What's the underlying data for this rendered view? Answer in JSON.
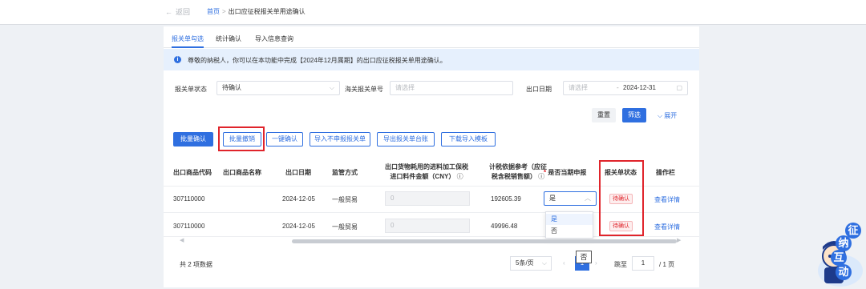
{
  "header": {
    "back_label": "返回",
    "breadcrumb_home": "首页",
    "breadcrumb_sep": ">",
    "breadcrumb_current": "出口应征税报关单用途确认"
  },
  "tabs": [
    "报关单勾选",
    "统计确认",
    "导入信息查询"
  ],
  "notice": {
    "icon": "info-icon",
    "text": "尊敬的纳税人，你可以在本功能中完成【2024年12月属期】的出口应征税报关单用途确认。"
  },
  "filters": {
    "status_label": "报关单状态",
    "status_value": "待确认",
    "customs_no_label": "海关报关单号",
    "customs_no_placeholder": "请选择",
    "export_date_label": "出口日期",
    "date_start_placeholder": "请选择",
    "date_sep": "-",
    "date_end": "2024-12-31",
    "reset_label": "重置",
    "search_label": "筛选",
    "expand_label": "展开"
  },
  "toolbar": {
    "batch_confirm": "批量确认",
    "batch_cancel": "批量撤销",
    "one_click_confirm": "一键确认",
    "import_no_declare": "导入不申报报关单",
    "export_ledger": "导出报关单台账",
    "download_template": "下载导入模板"
  },
  "table": {
    "headers": {
      "code": "出口商品代码",
      "name": "出口商品名称",
      "date": "出口日期",
      "supervision": "监管方式",
      "amount_l1": "出口货物耗用的进料加工保税",
      "amount_l2": "进口料件金额（CNY）",
      "basis_l1": "计税依据参考（应征",
      "basis_l2": "税含税销售额）",
      "declare": "是否当期申报",
      "declare_required": "*",
      "status": "报关单状态",
      "action": "操作栏"
    },
    "rows": [
      {
        "code": "307110000",
        "name": "",
        "date": "2024-12-05",
        "supervision": "一般贸易",
        "amount": "0",
        "basis": "192605.39",
        "declare": "是",
        "status": "待确认",
        "action": "查看详情"
      },
      {
        "code": "307110000",
        "name": "",
        "date": "2024-12-05",
        "supervision": "一般贸易",
        "amount": "0",
        "basis": "49996.48",
        "declare": "",
        "status": "待确认",
        "action": "查看详情"
      }
    ],
    "declare_options": [
      "是",
      "否"
    ]
  },
  "pagination": {
    "total": "共 2 项数据",
    "page_size": "5条/页",
    "jump_label": "跳至",
    "jump_value": "1",
    "page_total": "/ 1 页"
  },
  "tooltip": "否",
  "mascot": {
    "chars": [
      "征",
      "纳",
      "互",
      "动"
    ]
  },
  "colors": {
    "accent": "#2f6fe0",
    "highlight": "#e0242b",
    "notice_bg": "#e6f0fd"
  }
}
